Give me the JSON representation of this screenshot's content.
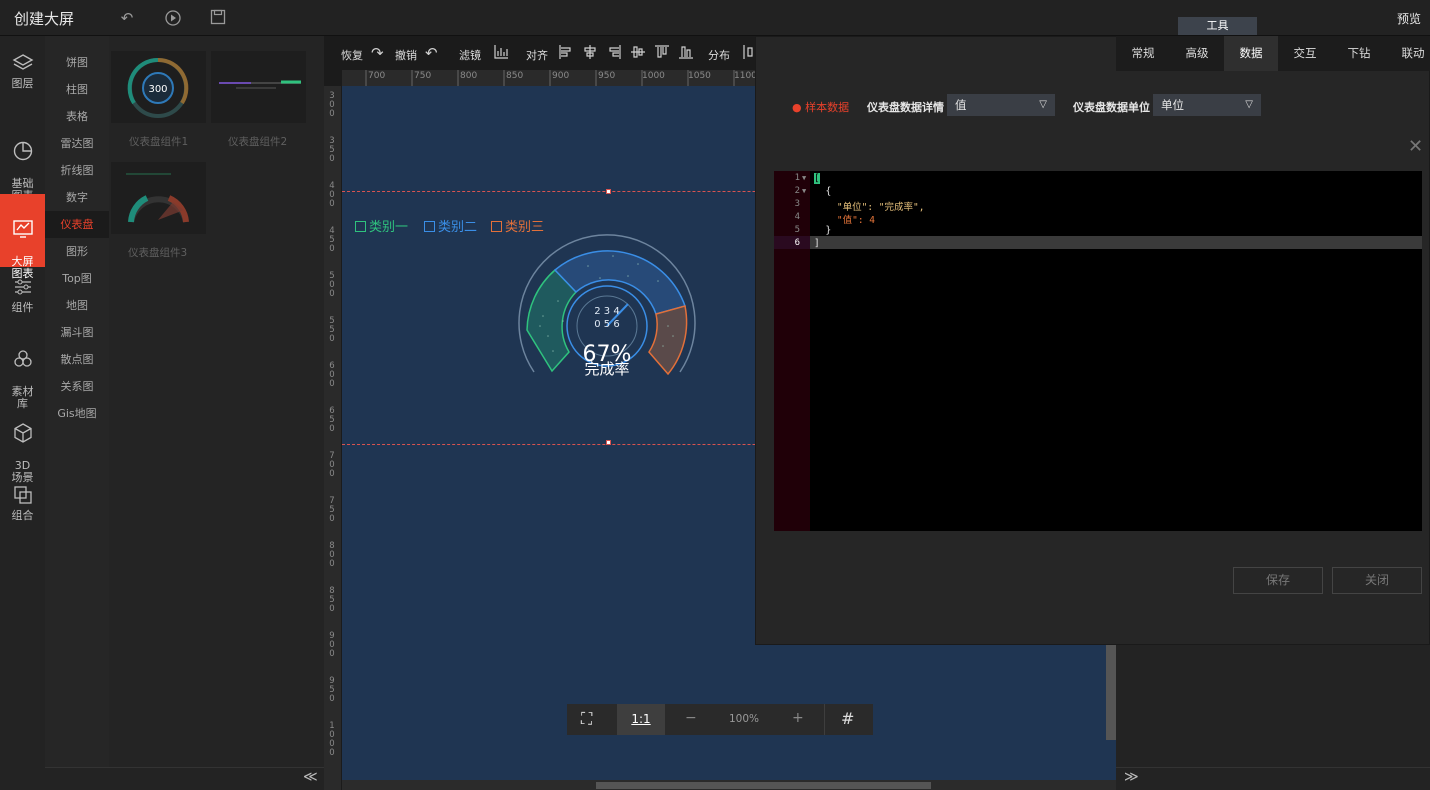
{
  "app": {
    "title": "创建大屏",
    "tools_tab": "工具",
    "preview": "预览"
  },
  "leftnav": [
    {
      "label": "图层"
    },
    {
      "label": "基础\n图表"
    },
    {
      "label": "大屏\n图表"
    },
    {
      "label": "组件"
    },
    {
      "label": "素材\n库"
    },
    {
      "label": "3D\n场景"
    },
    {
      "label": "组合"
    }
  ],
  "categories": [
    "饼图",
    "柱图",
    "表格",
    "雷达图",
    "折线图",
    "数字",
    "仪表盘",
    "图形",
    "Top图",
    "地图",
    "漏斗图",
    "散点图",
    "关系图",
    "Gis地图"
  ],
  "thumbs": [
    {
      "label": "仪表盘组件1",
      "value": "300"
    },
    {
      "label": "仪表盘组件2"
    },
    {
      "label": "仪表盘组件3"
    }
  ],
  "toolbar": {
    "redo": "恢复",
    "undo": "撤销",
    "filter": "滤镜",
    "align": "对齐",
    "distribute": "分布",
    "chart": "图表"
  },
  "ruler_h": [
    "700",
    "750",
    "800",
    "850",
    "900",
    "950",
    "1000",
    "1050",
    "1100"
  ],
  "ruler_v": [
    "300",
    "350",
    "400",
    "450",
    "500",
    "550",
    "600",
    "650",
    "700",
    "750",
    "800",
    "850",
    "900",
    "950",
    "1000"
  ],
  "gauge": {
    "legend": [
      {
        "label": "类别一",
        "color": "#2fc27e"
      },
      {
        "label": "类别二",
        "color": "#3a8ee6"
      },
      {
        "label": "类别三",
        "color": "#e2703a"
      }
    ],
    "percent": "67%",
    "unit": "完成率",
    "dial_digits_top": "2 3 4",
    "dial_digits_bottom": "0 5 6"
  },
  "zoom": {
    "fit": "⛶",
    "one_to_one": "1:1",
    "minus": "−",
    "level": "100%",
    "plus": "+",
    "grid": "#"
  },
  "tabs": [
    "常规",
    "高级",
    "数据",
    "交互",
    "下钻",
    "联动"
  ],
  "active_tab": "数据",
  "data_panel": {
    "sample_label": "样本数据",
    "detail_label": "仪表盘数据详情",
    "detail_value": "值",
    "unit_label": "仪表盘数据单位",
    "unit_value": "单位"
  },
  "editor": {
    "lines": [
      {
        "n": "1",
        "text": "["
      },
      {
        "n": "2",
        "text": "  {"
      },
      {
        "n": "3",
        "text": "    \"单位\": \"完成率\","
      },
      {
        "n": "4",
        "text": "    \"值\": 4"
      },
      {
        "n": "5",
        "text": "  }"
      },
      {
        "n": "6",
        "text": "]"
      }
    ]
  },
  "buttons": {
    "save": "保存",
    "close": "关闭"
  },
  "footer": {
    "collapse_left": "≪",
    "collapse_right": "≫"
  }
}
